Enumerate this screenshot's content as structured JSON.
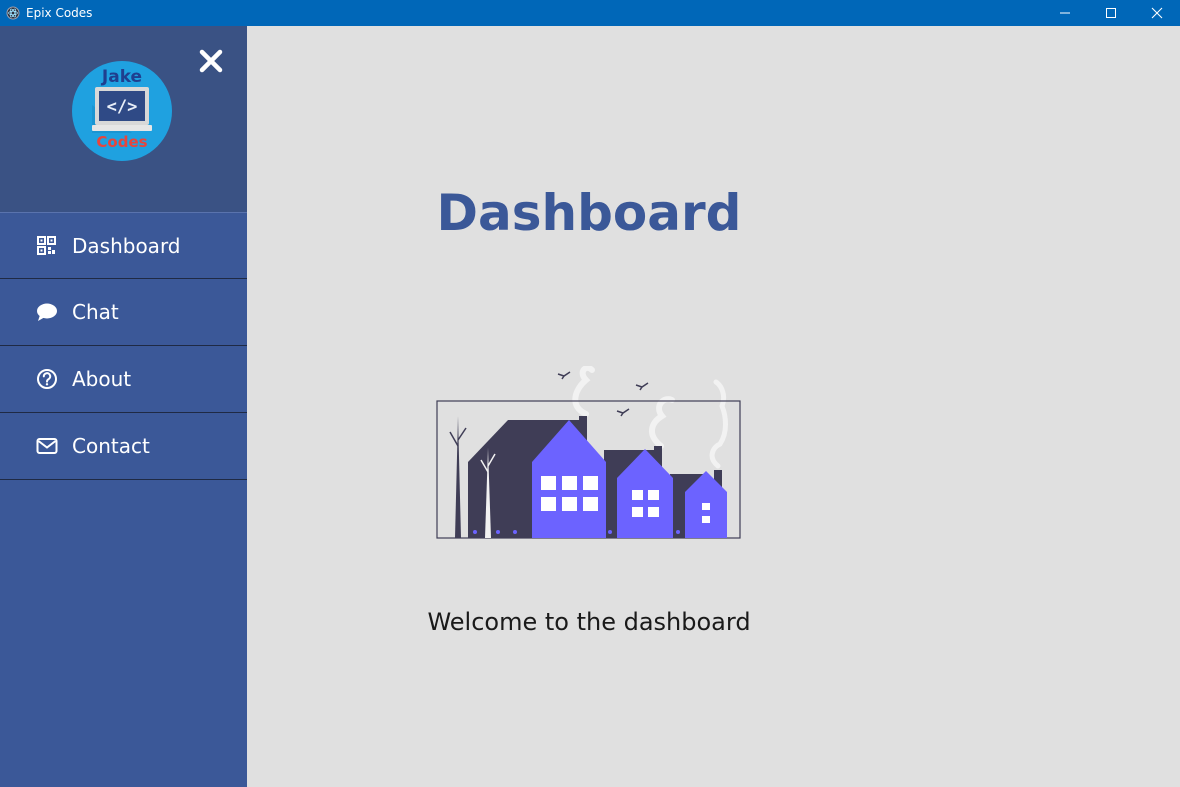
{
  "window": {
    "title": "Epix Codes",
    "titlebar_color": "#0067b8"
  },
  "sidebar": {
    "background": "#3b5898",
    "logo": {
      "top_text": "Jake",
      "bottom_text": "Codes"
    },
    "items": [
      {
        "label": "Dashboard",
        "icon": "dashboard-grid-icon"
      },
      {
        "label": "Chat",
        "icon": "chat-bubble-icon"
      },
      {
        "label": "About",
        "icon": "question-circle-icon"
      },
      {
        "label": "Contact",
        "icon": "envelope-icon"
      }
    ]
  },
  "main": {
    "title": "Dashboard",
    "welcome_text": "Welcome to the dashboard",
    "accent": "#3b5898",
    "illustration_color": "#6c63ff"
  }
}
